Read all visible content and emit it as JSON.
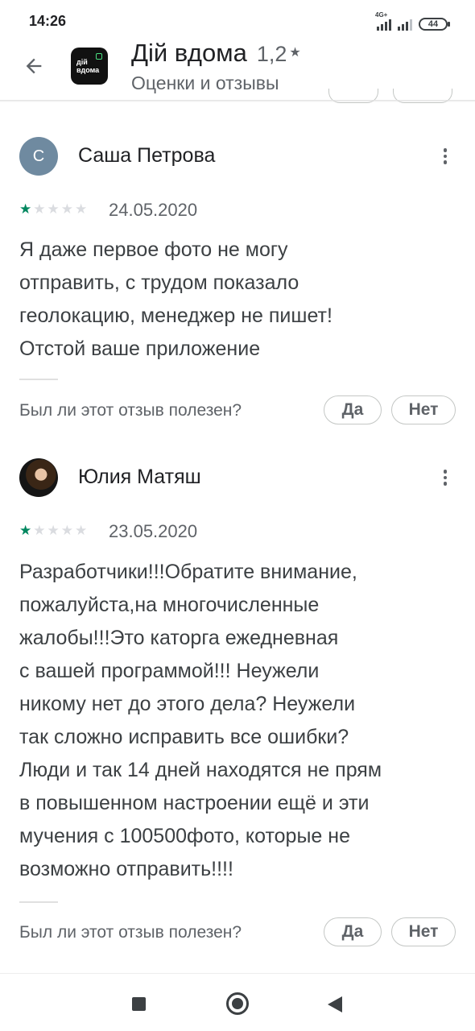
{
  "status_bar": {
    "time": "14:26",
    "network_type": "4G+",
    "battery": "44"
  },
  "header": {
    "back_icon": "arrow-left-icon",
    "app_icon_text_line1": "дій",
    "app_icon_text_line2": "вдома",
    "app_name": "Дій вдома",
    "rating": "1,2",
    "rating_star": "★",
    "subtitle": "Оценки и отзывы"
  },
  "reviews": [
    {
      "avatar_letter": "С",
      "avatar_color": "#6f8aa0",
      "author": "Саша Петрова",
      "stars": [
        "★",
        "★",
        "★",
        "★",
        "★"
      ],
      "rating": 1,
      "date": "24.05.2020",
      "text": [
        "Я даже первое фото не могу",
        "отправить, с трудом показало",
        "геолокацию, менеджер не пишет!",
        "Отстой ваше приложение"
      ],
      "helpful_question": "Был ли этот отзыв полезен?",
      "yes_label": "Да",
      "no_label": "Нет"
    },
    {
      "avatar_letter": "",
      "avatar_color": "#151515",
      "author": "Юлия Матяш",
      "stars": [
        "★",
        "★",
        "★",
        "★",
        "★"
      ],
      "rating": 1,
      "date": "23.05.2020",
      "text": [
        "Разработчики!!!Обратите внимание,",
        "пожалуйста,на многочисленные",
        "жалобы!!!Это каторга ежедневная",
        "с вашей программой!!! Неужели",
        "никому нет до этого дела? Неужели",
        "так сложно исправить все ошибки?",
        "Люди и так 14 дней находятся не прям",
        "в повышенном настроении ещё и эти",
        "мучения с 100500фото, которые не",
        "возможно отправить!!!!"
      ],
      "helpful_question": "Был ли этот отзыв полезен?",
      "yes_label": "Да",
      "no_label": "Нет"
    }
  ],
  "colors": {
    "star_filled": "#01875f",
    "star_empty": "#dadce0",
    "text_primary": "#202124",
    "text_secondary": "#5f6368"
  },
  "nav_bar": {
    "recents_icon": "square-icon",
    "home_icon": "circle-home-icon",
    "back_icon": "triangle-back-icon"
  }
}
